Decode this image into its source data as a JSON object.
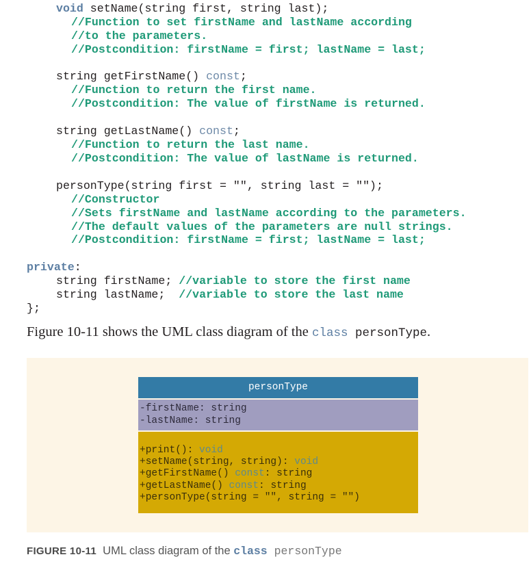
{
  "code": {
    "setName": {
      "kw": "void",
      "sig": " setName(string first, string last);",
      "comments": [
        "//Function to set firstName and lastName according",
        "//to the parameters.",
        "//Postcondition: firstName = first; lastName = last;"
      ]
    },
    "getFirstName": {
      "sig": "string getFirstName() ",
      "kw": "const",
      "end": ";",
      "comments": [
        "//Function to return the first name.",
        "//Postcondition: The value of firstName is returned."
      ]
    },
    "getLastName": {
      "sig": "string getLastName() ",
      "kw": "const",
      "end": ";",
      "comments": [
        "//Function to return the last name.",
        "//Postcondition: The value of lastName is returned."
      ]
    },
    "constructor": {
      "sig": "personType(string first = \"\", string last = \"\");",
      "comments": [
        "//Constructor",
        "//Sets firstName and lastName according to the parameters.",
        "//The default values of the parameters are null strings.",
        "//Postcondition: firstName = first; lastName = last;"
      ]
    },
    "private_kw": "private",
    "private_colon": ":",
    "members": [
      {
        "decl": "string firstName; ",
        "comment": "//variable to store the first name"
      },
      {
        "decl": "string lastName;  ",
        "comment": "//variable to store the last name"
      }
    ],
    "closing": "};"
  },
  "prose": {
    "before": "Figure 10-11 shows the UML class diagram of the ",
    "kw": "class",
    "name": " personType",
    "after": "."
  },
  "uml": {
    "class_name": "personType",
    "attributes": [
      "-firstName: string",
      "-lastName: string"
    ],
    "methods": [
      {
        "pre": "+print(): ",
        "kw": "void",
        "post": ""
      },
      {
        "pre": "+setName(string, string): ",
        "kw": "void",
        "post": ""
      },
      {
        "pre": "+getFirstName() ",
        "kw": "const",
        "post": ": string"
      },
      {
        "pre": "+getLastName() ",
        "kw": "const",
        "post": ": string"
      },
      {
        "pre": "+personType(string = \"\", string = \"\")",
        "kw": "",
        "post": ""
      }
    ],
    "colors": {
      "header": "#337ba6",
      "attributes": "#a09dbf",
      "methods": "#d4a904",
      "figure_background": "#fdf5e6"
    }
  },
  "caption": {
    "label": "FIGURE 10-11",
    "text": "  UML class diagram of the ",
    "kw": "class",
    "name": " personType"
  }
}
